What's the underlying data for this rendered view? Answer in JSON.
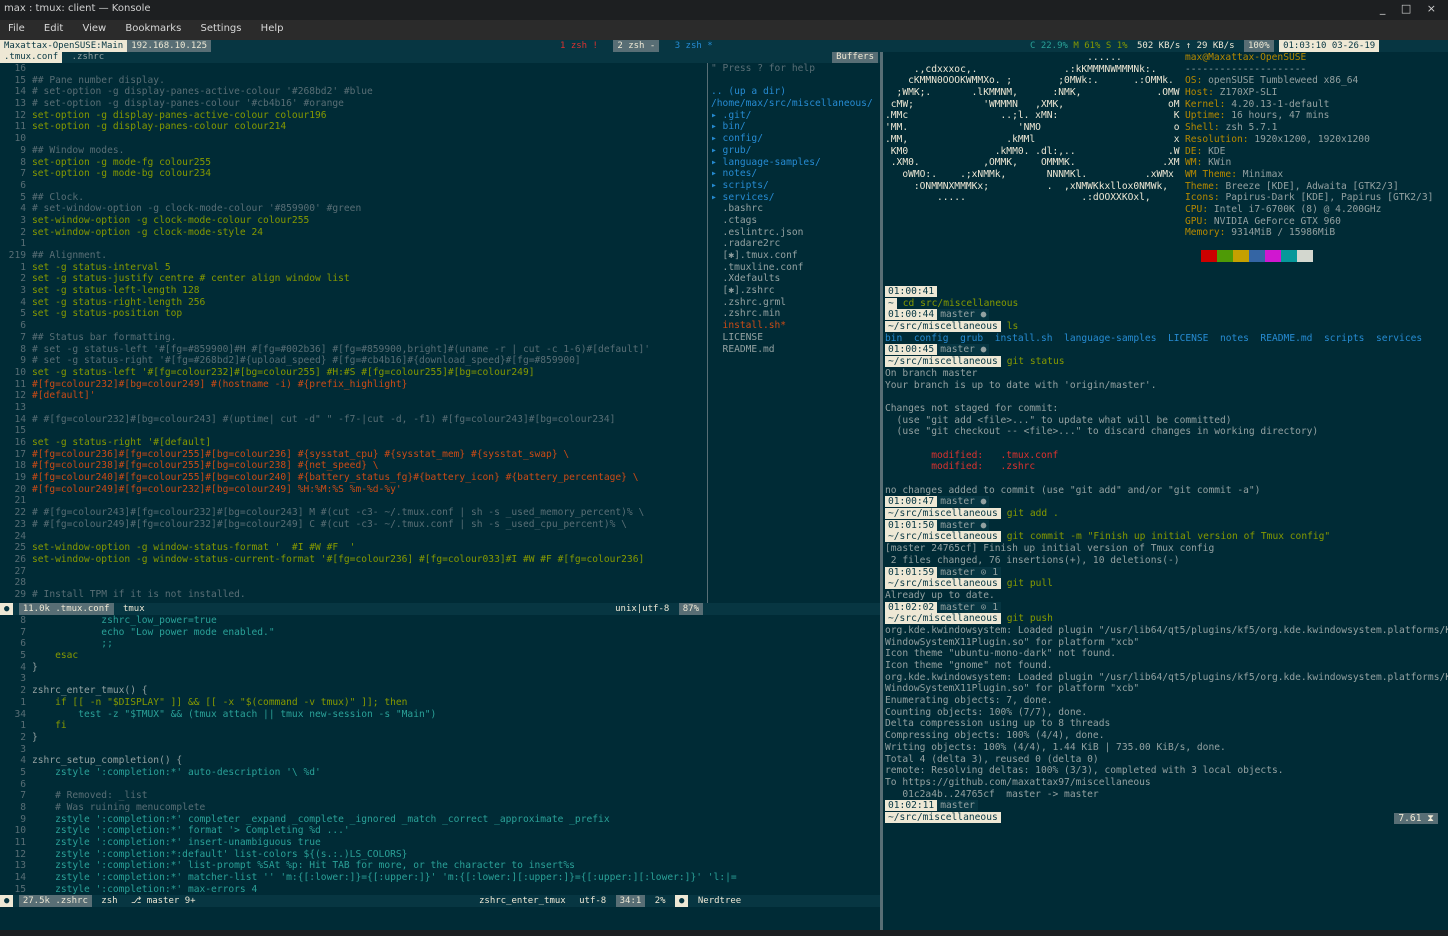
{
  "window": {
    "title": "max : tmux: client — Konsole",
    "controls": "_ □ ×"
  },
  "menu": [
    "File",
    "Edit",
    "View",
    "Bookmarks",
    "Settings",
    "Help"
  ],
  "tmux": {
    "session": "Maxattax-OpenSUSE:Main",
    "ip": "192.168.10.125",
    "win1": "1 zsh !",
    "win2": "2 zsh -",
    "win3": "3 zsh *",
    "cpu": "C 22.9%",
    "mem": "M 61%",
    "swap": "S 1%",
    "net": "502 KB/s ↑ 29 KB/s",
    "battery": "100%",
    "clock": "01:03:10 03-26-19"
  },
  "editor": {
    "tab1": ".tmux.conf",
    "tab2": ".zshrc",
    "buffers_label": "Buffers",
    "top_status": {
      "size": "11.0k .tmux.conf",
      "ft": "tmux",
      "enc": "unix|utf-8",
      "pct": "87%"
    },
    "bottom_status": {
      "size": "27.5k .zshrc",
      "ft": "zsh",
      "branch": "master",
      "changes": "9+",
      "func": "zshrc_enter_tmux",
      "enc": "utf-8",
      "pos": "34:1",
      "pct": "2%",
      "tree": "Nerdtree"
    },
    "tmux_lines": [
      {
        "n": "16",
        "t": ""
      },
      {
        "n": "15",
        "t": "## Pane number display.",
        "c": "cm"
      },
      {
        "n": "14",
        "t": "# set-option -g display-panes-active-colour '#268bd2' #blue",
        "c": "cm"
      },
      {
        "n": "13",
        "t": "# set-option -g display-panes-colour '#cb4b16' #orange",
        "c": "cm"
      },
      {
        "n": "12",
        "t": "set-option -g display-panes-active-colour colour196",
        "c": "kw"
      },
      {
        "n": "11",
        "t": "set-option -g display-panes-colour colour214",
        "c": "kw"
      },
      {
        "n": "10",
        "t": ""
      },
      {
        "n": "9",
        "t": "## Window modes.",
        "c": "cm"
      },
      {
        "n": "8",
        "t": "set-option -g mode-fg colour255",
        "c": "kw"
      },
      {
        "n": "7",
        "t": "set-option -g mode-bg colour234",
        "c": "kw"
      },
      {
        "n": "6",
        "t": ""
      },
      {
        "n": "5",
        "t": "## Clock.",
        "c": "cm"
      },
      {
        "n": "4",
        "t": "# set-window-option -g clock-mode-colour '#859900' #green",
        "c": "cm"
      },
      {
        "n": "3",
        "t": "set-window-option -g clock-mode-colour colour255",
        "c": "kw"
      },
      {
        "n": "2",
        "t": "set-window-option -g clock-mode-style 24",
        "c": "kw"
      },
      {
        "n": "1",
        "t": ""
      },
      {
        "n": "219",
        "t": "## Alignment.",
        "c": "cm"
      },
      {
        "n": "1",
        "t": "set -g status-interval 5",
        "c": "kw"
      },
      {
        "n": "2",
        "t": "set -g status-justify centre # center align window list",
        "c": "kw"
      },
      {
        "n": "3",
        "t": "set -g status-left-length 128",
        "c": "kw"
      },
      {
        "n": "4",
        "t": "set -g status-right-length 256",
        "c": "kw"
      },
      {
        "n": "5",
        "t": "set -g status-position top",
        "c": "kw"
      },
      {
        "n": "6",
        "t": ""
      },
      {
        "n": "7",
        "t": "## Status bar formatting.",
        "c": "cm"
      },
      {
        "n": "8",
        "t": "# set -g status-left '#[fg=#859900]#H #[fg=#002b36] #[fg=#859900,bright]#(uname -r | cut -c 1-6)#[default]'",
        "c": "cm"
      },
      {
        "n": "9",
        "t": "# set -g status-right '#[fg=#268bd2]#{upload_speed} #[fg=#cb4b16]#{download_speed}#[fg=#859900]",
        "c": "cm"
      },
      {
        "n": "10",
        "t": "set -g status-left '#[fg=colour232]#[bg=colour255] #H:#S #[fg=colour255]#[bg=colour249]",
        "c": "kw"
      },
      {
        "n": "11",
        "t": "#[fg=colour232]#[bg=colour249] #(hostname -i) #{prefix_highlight}",
        "c": "or"
      },
      {
        "n": "12",
        "t": "#[default]'",
        "c": "or"
      },
      {
        "n": "13",
        "t": ""
      },
      {
        "n": "14",
        "t": "# #[fg=colour232]#[bg=colour243] #(uptime| cut -d\" \" -f7-|cut -d, -f1) #[fg=colour243]#[bg=colour234]",
        "c": "cm"
      },
      {
        "n": "15",
        "t": ""
      },
      {
        "n": "16",
        "t": "set -g status-right '#[default]",
        "c": "kw"
      },
      {
        "n": "17",
        "t": "#[fg=colour236]#[fg=colour255]#[bg=colour236] #{sysstat_cpu} #{sysstat_mem} #{sysstat_swap} \\",
        "c": "or"
      },
      {
        "n": "18",
        "t": "#[fg=colour238]#[fg=colour255]#[bg=colour238] #{net_speed} \\",
        "c": "or"
      },
      {
        "n": "19",
        "t": "#[fg=colour240]#[fg=colour255]#[bg=colour240] #{battery_status_fg}#{battery_icon} #{battery_percentage} \\",
        "c": "or"
      },
      {
        "n": "20",
        "t": "#[fg=colour249]#[fg=colour232]#[bg=colour249] %H:%M:%S %m-%d-%y'",
        "c": "or"
      },
      {
        "n": "21",
        "t": ""
      },
      {
        "n": "22",
        "t": "# #[fg=colour243]#[fg=colour232]#[bg=colour243] M #(cut -c3- ~/.tmux.conf | sh -s _used_memory_percent)% \\",
        "c": "cm"
      },
      {
        "n": "23",
        "t": "# #[fg=colour249]#[fg=colour232]#[bg=colour249] C #(cut -c3- ~/.tmux.conf | sh -s _used_cpu_percent)% \\",
        "c": "cm"
      },
      {
        "n": "24",
        "t": ""
      },
      {
        "n": "25",
        "t": "set-window-option -g window-status-format '  #I #W #F  '",
        "c": "kw"
      },
      {
        "n": "26",
        "t": "set-window-option -g window-status-current-format '#[fg=colour236] #[fg=colour033]#I #W #F #[fg=colour236]",
        "c": "kw"
      },
      {
        "n": "27",
        "t": ""
      },
      {
        "n": "28",
        "t": ""
      },
      {
        "n": "29",
        "t": "# Install TPM if it is not installed.",
        "c": "cm"
      }
    ],
    "zsh_lines": [
      {
        "n": "8",
        "t": "            zshrc_low_power=true",
        "c": "st"
      },
      {
        "n": "7",
        "t": "            echo \"Low power mode enabled.\"",
        "c": "st"
      },
      {
        "n": "6",
        "t": "            ;;",
        "c": "st"
      },
      {
        "n": "5",
        "t": "    esac",
        "c": "kw"
      },
      {
        "n": "4",
        "t": "}",
        "c": ""
      },
      {
        "n": "3",
        "t": ""
      },
      {
        "n": "2",
        "t": "zshrc_enter_tmux() {",
        "c": ""
      },
      {
        "n": "1",
        "t": "    if [[ -n \"$DISPLAY\" ]] && [[ -x \"$(command -v tmux)\" ]]; then",
        "c": "kw"
      },
      {
        "n": "34",
        "t": "        test -z \"$TMUX\" && (tmux attach || tmux new-session -s \"Main\")",
        "c": "st"
      },
      {
        "n": "1",
        "t": "    fi",
        "c": "kw"
      },
      {
        "n": "2",
        "t": "}",
        "c": ""
      },
      {
        "n": "3",
        "t": ""
      },
      {
        "n": "4",
        "t": "zshrc_setup_completion() {",
        "c": ""
      },
      {
        "n": "5",
        "t": "    zstyle ':completion:*' auto-description '\\ %d'",
        "c": "st"
      },
      {
        "n": "6",
        "t": ""
      },
      {
        "n": "7",
        "t": "    # Removed: _list",
        "c": "cm"
      },
      {
        "n": "8",
        "t": "    # Was ruining menucomplete",
        "c": "cm"
      },
      {
        "n": "9",
        "t": "    zstyle ':completion:*' completer _expand _complete _ignored _match _correct _approximate _prefix",
        "c": "st"
      },
      {
        "n": "10",
        "t": "    zstyle ':completion:*' format '> Completing %d ...'",
        "c": "st"
      },
      {
        "n": "11",
        "t": "    zstyle ':completion:*' insert-unambiguous true",
        "c": "st"
      },
      {
        "n": "12",
        "t": "    zstyle ':completion:*:default' list-colors ${(s.:.)LS_COLORS}",
        "c": "st"
      },
      {
        "n": "13",
        "t": "    zstyle ':completion:*' list-prompt %SAt %p: Hit TAB for more, or the character to insert%s",
        "c": "st"
      },
      {
        "n": "14",
        "t": "    zstyle ':completion:*' matcher-list '' 'm:{[:lower:]}={[:upper:]}' 'm:{[:lower:][:upper:]}={[:upper:][:lower:]}' 'l:|=",
        "c": "st"
      },
      {
        "n": "15",
        "t": "    zstyle ':completion:*' max-errors 4",
        "c": "st"
      }
    ],
    "tree": [
      {
        "t": "\" Press ? for help",
        "c": "cm"
      },
      {
        "t": ""
      },
      {
        "t": ".. (up a dir)",
        "c": "bl"
      },
      {
        "t": "/home/max/src/miscellaneous/",
        "c": "bl"
      },
      {
        "t": "▸ .git/",
        "c": "bl"
      },
      {
        "t": "▸ bin/",
        "c": "bl"
      },
      {
        "t": "▸ config/",
        "c": "bl"
      },
      {
        "t": "▸ grub/",
        "c": "bl"
      },
      {
        "t": "▸ language-samples/",
        "c": "bl"
      },
      {
        "t": "▸ notes/",
        "c": "bl"
      },
      {
        "t": "▸ scripts/",
        "c": "bl"
      },
      {
        "t": "▸ services/",
        "c": "bl"
      },
      {
        "t": "  .bashrc"
      },
      {
        "t": "  .ctags"
      },
      {
        "t": "  .eslintrc.json"
      },
      {
        "t": "  .radare2rc"
      },
      {
        "t": "  [✱].tmux.conf"
      },
      {
        "t": "  .tmuxline.conf"
      },
      {
        "t": "  .Xdefaults"
      },
      {
        "t": "  [✱].zshrc"
      },
      {
        "t": "  .zshrc.grml"
      },
      {
        "t": "  .zshrc.min"
      },
      {
        "t": "  install.sh*",
        "c": "or"
      },
      {
        "t": "  LICENSE"
      },
      {
        "t": "  README.md"
      }
    ]
  },
  "neofetch": {
    "logo": [
      "                                   ......",
      "     .,cdxxxoc,.               .:kKMMMNWMMMNk:.",
      "    cKMMN0OOOKWMMXo. ;        ;0MWk:.      .:OMMk.",
      "  ;WMK;.       .lKMMNM,      :NMK,             .OMW;",
      " cMW;            'WMMMN   ,XMK,                  oMM'",
      ".MMc                ..;l. xMN:                    KM0",
      "'MM.                   'NMO                       oMM",
      ".MM,                 .kMMl                        xMN",
      " KM0               .kMM0. .dl:,..                .WMd",
      " .XM0.           ,OMMK,    OMMMK.               .XMK",
      "   oWMO:.    .;xNMMk,       NNNMKl.          .xWMx",
      "     :ONMMNXMMMKx;          .  ,xNMWKkxllox0NMWk,",
      "         .....                    .:dOOXXKOxl,"
    ],
    "userhost": "max@Maxattax-OpenSUSE",
    "sep": "---------------------",
    "info": [
      {
        "k": "OS",
        "v": "openSUSE Tumbleweed x86_64"
      },
      {
        "k": "Host",
        "v": "Z170XP-SLI"
      },
      {
        "k": "Kernel",
        "v": "4.20.13-1-default"
      },
      {
        "k": "Uptime",
        "v": "16 hours, 47 mins"
      },
      {
        "k": "Shell",
        "v": "zsh 5.7.1"
      },
      {
        "k": "Resolution",
        "v": "1920x1200, 1920x1200"
      },
      {
        "k": "DE",
        "v": "KDE"
      },
      {
        "k": "WM",
        "v": "KWin"
      },
      {
        "k": "WM Theme",
        "v": "Minimax"
      },
      {
        "k": "Theme",
        "v": "Breeze [KDE], Adwaita [GTK2/3]"
      },
      {
        "k": "Icons",
        "v": "Papirus-Dark [KDE], Papirus [GTK2/3]"
      },
      {
        "k": "CPU",
        "v": "Intel i7-6700K (8) @ 4.200GHz"
      },
      {
        "k": "GPU",
        "v": "NVIDIA GeForce GTX 960"
      },
      {
        "k": "Memory",
        "v": "9314MiB / 15986MiB"
      }
    ],
    "palette": [
      "#cc0000",
      "#4e9a06",
      "#c4a000",
      "#3465a4",
      "#d017d0",
      "#06989a",
      "#d3d7cf"
    ]
  },
  "terminal": {
    "lines": [
      {
        "time": "01:00:41"
      },
      {
        "p": "~",
        "cmd": "cd src/miscellaneous"
      },
      {
        "time": "01:00:44",
        "git": "master ●"
      },
      {
        "p": "~/src/miscellaneous",
        "cmd": "ls"
      },
      {
        "ls": "bin  config  grub  install.sh  language-samples  LICENSE  notes  README.md  scripts  services"
      },
      {
        "time": "01:00:45",
        "git": "master ●"
      },
      {
        "p": "~/src/miscellaneous",
        "cmd": "git status"
      },
      {
        "o": "On branch master"
      },
      {
        "o": "Your branch is up to date with 'origin/master'."
      },
      {
        "o": ""
      },
      {
        "o": "Changes not staged for commit:"
      },
      {
        "o": "  (use \"git add <file>...\" to update what will be committed)"
      },
      {
        "o": "  (use \"git checkout -- <file>...\" to discard changes in working directory)"
      },
      {
        "o": ""
      },
      {
        "m": "        modified:   .tmux.conf"
      },
      {
        "m": "        modified:   .zshrc"
      },
      {
        "o": ""
      },
      {
        "o": "no changes added to commit (use \"git add\" and/or \"git commit -a\")"
      },
      {
        "time": "01:00:47",
        "git": "master ●"
      },
      {
        "p": "~/src/miscellaneous",
        "cmd": "git add ."
      },
      {
        "time": "01:01:50",
        "git": "master ●"
      },
      {
        "p": "~/src/miscellaneous",
        "cmd": "git commit -m \"Finish up initial version of Tmux config\""
      },
      {
        "o": "[master 24765cf] Finish up initial version of Tmux config"
      },
      {
        "o": " 2 files changed, 76 insertions(+), 10 deletions(-)"
      },
      {
        "time": "01:01:59",
        "git": "master ⊙ 1"
      },
      {
        "p": "~/src/miscellaneous",
        "cmd": "git pull"
      },
      {
        "o": "Already up to date."
      },
      {
        "time": "01:02:02",
        "git": "master ⊙ 1"
      },
      {
        "p": "~/src/miscellaneous",
        "cmd": "git push"
      },
      {
        "o": "org.kde.kwindowsystem: Loaded plugin \"/usr/lib64/qt5/plugins/kf5/org.kde.kwindowsystem.platforms/KF5"
      },
      {
        "o": "WindowSystemX11Plugin.so\" for platform \"xcb\""
      },
      {
        "o": "Icon theme \"ubuntu-mono-dark\" not found."
      },
      {
        "o": "Icon theme \"gnome\" not found."
      },
      {
        "o": "org.kde.kwindowsystem: Loaded plugin \"/usr/lib64/qt5/plugins/kf5/org.kde.kwindowsystem.platforms/KF5"
      },
      {
        "o": "WindowSystemX11Plugin.so\" for platform \"xcb\""
      },
      {
        "o": "Enumerating objects: 7, done."
      },
      {
        "o": "Counting objects: 100% (7/7), done."
      },
      {
        "o": "Delta compression using up to 8 threads"
      },
      {
        "o": "Compressing objects: 100% (4/4), done."
      },
      {
        "o": "Writing objects: 100% (4/4), 1.44 KiB | 735.00 KiB/s, done."
      },
      {
        "o": "Total 4 (delta 3), reused 0 (delta 0)"
      },
      {
        "o": "remote: Resolving deltas: 100% (3/3), completed with 3 local objects."
      },
      {
        "o": "To https://github.com/maxattax97/miscellaneous"
      },
      {
        "o": "   01c2a4b..24765cf  master -> master"
      },
      {
        "time": "01:02:11",
        "git": "master"
      },
      {
        "p": "~/src/miscellaneous",
        "cmd": ""
      }
    ],
    "rprompt": "7.61 ⧗"
  }
}
